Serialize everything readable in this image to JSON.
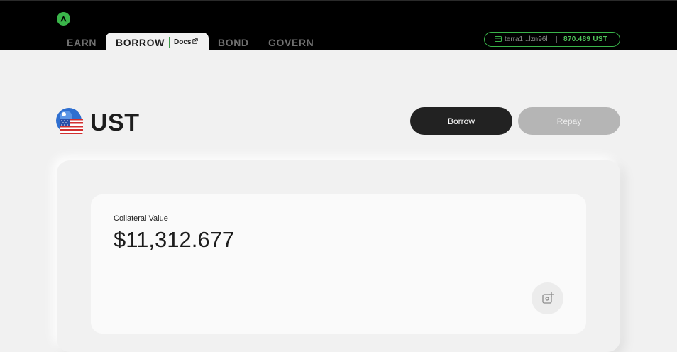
{
  "header": {
    "logo_icon": "anchor-logo-icon",
    "nav": {
      "earn": "EARN",
      "borrow": "BORROW",
      "docs": "Docs",
      "bond": "BOND",
      "govern": "GOVERN"
    },
    "wallet": {
      "address": "terra1...lzn96l",
      "balance": "870.489 UST",
      "icon": "wallet-card-icon"
    }
  },
  "main": {
    "token_icon": "us-flag-coin-icon",
    "title": "UST",
    "borrow_label": "Borrow",
    "repay_label": "Repay",
    "collateral": {
      "label": "Collateral Value",
      "value": "$11,312.677"
    },
    "action_icon": "add-collateral-icon"
  },
  "colors": {
    "accent": "#3ab54a",
    "topbar": "#000000",
    "background": "#f1f1f1"
  }
}
